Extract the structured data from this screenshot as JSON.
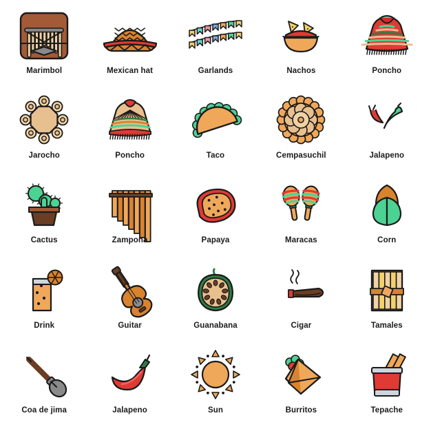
{
  "grid": {
    "columns": 5,
    "rows": 5,
    "background": "#ffffff",
    "label_color": "#1a1a1a"
  },
  "palette": {
    "outline": "#1a1a1a",
    "red": "#e03a34",
    "red_dark": "#d02b26",
    "green": "#4cd292",
    "green_dark": "#2e7d44",
    "orange": "#efa85a",
    "orange_dark": "#d9832f",
    "tan": "#e8c08f",
    "tan_light": "#f0d2a4",
    "brown": "#a25a37",
    "brown_dark": "#6b3e23",
    "gray": "#8a8a8a",
    "gray_light": "#ccd6dd",
    "yellow": "#f2d16b",
    "teal": "#6fd3c4",
    "pink": "#f29aa8",
    "blue": "#7ba7d9"
  },
  "icons": [
    {
      "name": "marimbol",
      "label": "Marimbol",
      "icon": "marimbol-icon"
    },
    {
      "name": "mexican-hat",
      "label": "Mexican hat",
      "icon": "sombrero-icon"
    },
    {
      "name": "garlands",
      "label": "Garlands",
      "icon": "garlands-icon"
    },
    {
      "name": "nachos",
      "label": "Nachos",
      "icon": "nachos-icon"
    },
    {
      "name": "poncho-1",
      "label": "Poncho",
      "icon": "poncho-red-icon"
    },
    {
      "name": "jarocho",
      "label": "Jarocho",
      "icon": "tambourine-icon"
    },
    {
      "name": "poncho-2",
      "label": "Poncho",
      "icon": "poncho-tan-icon"
    },
    {
      "name": "taco",
      "label": "Taco",
      "icon": "taco-icon"
    },
    {
      "name": "cempasuchil",
      "label": "Cempasuchil",
      "icon": "marigold-icon"
    },
    {
      "name": "jalapeno-1",
      "label": "Jalapeno",
      "icon": "two-chili-icon"
    },
    {
      "name": "cactus",
      "label": "Cactus",
      "icon": "cactus-icon"
    },
    {
      "name": "zampona",
      "label": "Zampona",
      "icon": "panflute-icon"
    },
    {
      "name": "papaya",
      "label": "Papaya",
      "icon": "papaya-icon"
    },
    {
      "name": "maracas",
      "label": "Maracas",
      "icon": "maracas-icon"
    },
    {
      "name": "corn",
      "label": "Corn",
      "icon": "corn-icon"
    },
    {
      "name": "drink",
      "label": "Drink",
      "icon": "drink-glass-icon"
    },
    {
      "name": "guitar",
      "label": "Guitar",
      "icon": "guitar-icon"
    },
    {
      "name": "guanabana",
      "label": "Guanabana",
      "icon": "guanabana-icon"
    },
    {
      "name": "cigar",
      "label": "Cigar",
      "icon": "cigar-icon"
    },
    {
      "name": "tamales",
      "label": "Tamales",
      "icon": "tamales-icon"
    },
    {
      "name": "coa-de-jima",
      "label": "Coa de jima",
      "icon": "coa-tool-icon"
    },
    {
      "name": "jalapeno-2",
      "label": "Jalapeno",
      "icon": "red-chili-icon"
    },
    {
      "name": "sun",
      "label": "Sun",
      "icon": "sun-icon"
    },
    {
      "name": "burritos",
      "label": "Burritos",
      "icon": "burrito-icon"
    },
    {
      "name": "tepache",
      "label": "Tepache",
      "icon": "tepache-cup-icon"
    }
  ]
}
